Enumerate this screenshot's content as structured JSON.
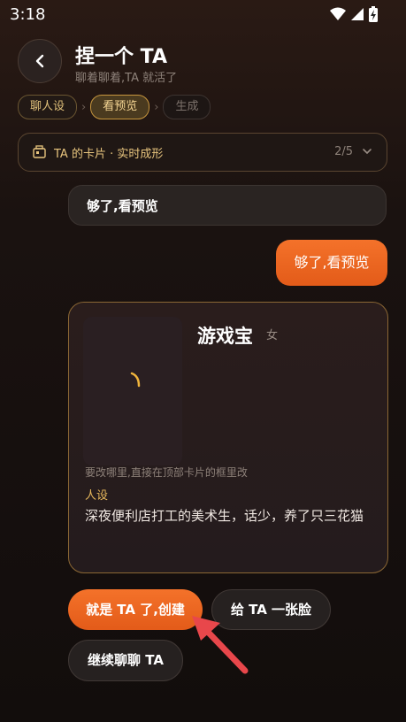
{
  "status": {
    "time": "3:18"
  },
  "header": {
    "title": "捏一个 TA",
    "subtitle": "聊着聊着,TA 就活了"
  },
  "steps": [
    {
      "label": "聊人设",
      "state": "done"
    },
    {
      "label": "看预览",
      "state": "active"
    },
    {
      "label": "生成",
      "state": "disabled"
    }
  ],
  "card_bar": {
    "label": "TA 的卡片 · 实时成形",
    "count": "2/5"
  },
  "chat": {
    "left_bubble": "够了,看预览",
    "right_bubble": "够了,看预览"
  },
  "character": {
    "name": "游戏宝",
    "gender": "女",
    "hint": "要改哪里,直接在顶部卡片的框里改",
    "persona_label": "人设",
    "persona_text": "深夜便利店打工的美术生，话少，养了只三花猫"
  },
  "actions": {
    "create": "就是 TA 了,创建",
    "give_face": "给 TA 一张脸",
    "continue": "继续聊聊 TA"
  },
  "colors": {
    "accent": "#f06a24",
    "gold": "#e8c57e",
    "arrow": "#e8474b"
  }
}
